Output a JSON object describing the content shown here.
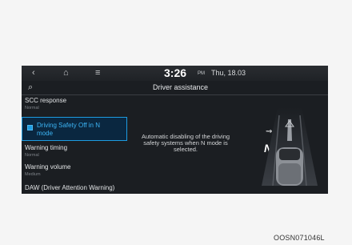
{
  "topbar": {
    "back_icon": "‹",
    "home_icon": "⌂",
    "menu_icon": "≡",
    "time": "3:26",
    "ampm": "PM",
    "date": "Thu, 18.03"
  },
  "header": {
    "search_icon": "⌕",
    "title": "Driver assistance"
  },
  "menu": {
    "items": [
      {
        "title": "SCC response",
        "sub": "Normal"
      },
      {
        "title": "Driving Safety Off in N",
        "title2": "mode",
        "checked": true
      },
      {
        "title": "Warning timing",
        "sub": "Normal"
      },
      {
        "title": "Warning volume",
        "sub": "Medium"
      },
      {
        "title": "DAW (Driver Attention Warning)"
      }
    ]
  },
  "detail": {
    "description": "Automatic disabling of the driving safety systems when N mode is selected.",
    "n_logo": "N",
    "sensor_icon": "⇝"
  },
  "caption": "OOSN071046L",
  "colors": {
    "accent": "#1d9be0",
    "screen_bg": "#1b1e22",
    "selected_bg": "#0a2740"
  }
}
